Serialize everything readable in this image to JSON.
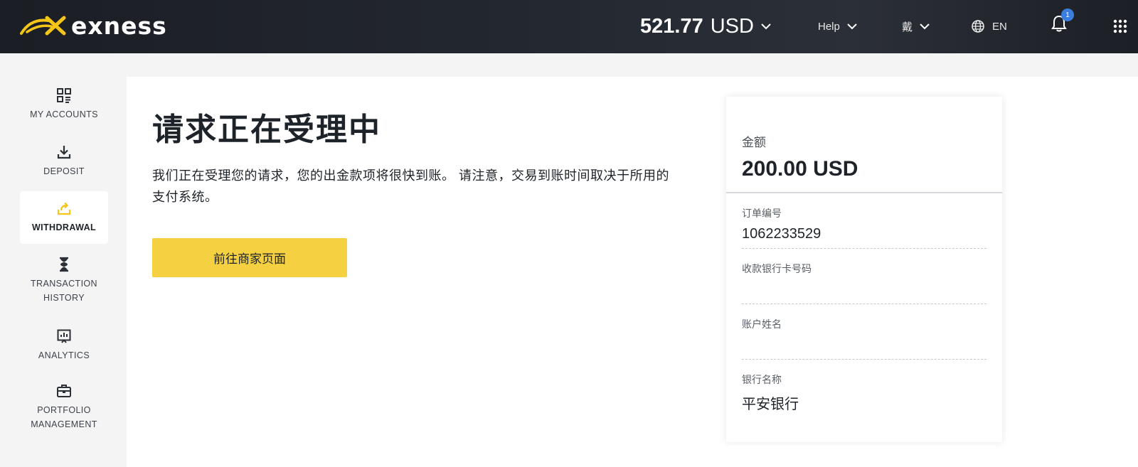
{
  "header": {
    "logo_text": "exness",
    "balance_amount": "521.77",
    "balance_currency": "USD",
    "help_label": "Help",
    "user_label": "戴",
    "lang_label": "EN",
    "notification_count": "1",
    "icons": [
      "logo-mark",
      "chevron-down-icon",
      "globe-icon",
      "bell-icon",
      "apps-grid-icon"
    ],
    "brand_color": "#f5d142",
    "header_bg": "#1f232a"
  },
  "sidebar": {
    "items": [
      {
        "label": "MY ACCOUNTS",
        "icon": "accounts-grid-icon",
        "active": false
      },
      {
        "label": "DEPOSIT",
        "icon": "download-icon",
        "active": false
      },
      {
        "label": "WITHDRAWAL",
        "icon": "withdraw-icon",
        "active": true
      },
      {
        "label_line1": "TRANSACTION",
        "label_line2": "HISTORY",
        "icon": "hourglass-icon",
        "active": false
      },
      {
        "label": "ANALYTICS",
        "icon": "analytics-icon",
        "active": false
      },
      {
        "label_line1": "PORTFOLIO",
        "label_line2": "MANAGEMENT",
        "icon": "briefcase-icon",
        "active": false
      }
    ],
    "accent_color": "#f5c518"
  },
  "main": {
    "title": "请求正在受理中",
    "description": "我们正在受理您的请求，您的出金款项将很快到账。 请注意，交易到账时间取决于所用的支付系统。",
    "cta_label": "前往商家页面"
  },
  "receipt": {
    "amount_label": "金额",
    "amount_value": "200.00 USD",
    "fields": [
      {
        "label": "订单编号",
        "value": "1062233529"
      },
      {
        "label": "收款银行卡号码",
        "value": ""
      },
      {
        "label": "账户姓名",
        "value": ""
      },
      {
        "label": "银行名称",
        "value": "平安银行"
      }
    ]
  }
}
